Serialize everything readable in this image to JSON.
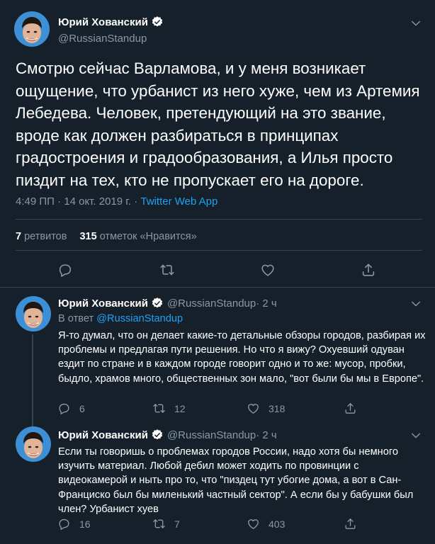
{
  "colors": {
    "background": "#15202b",
    "text": "#ffffff",
    "secondary": "#8899a6",
    "accent": "#1da1f2",
    "border": "#38444d",
    "avatar_bg": "#3d8fd6"
  },
  "main_tweet": {
    "display_name": "Юрий Хованский",
    "handle": "@RussianStandup",
    "text": "Смотрю сейчас Варламова, и у меня возникает ощущение, что урбанист из него хуже, чем из Артемия Лебедева. Человек, претендующий на это звание, вроде как должен разбираться в принципах градостроения и градообразования, а Илья просто пиздит на тех, кто не пропускает его на дороге.",
    "timestamp": "4:49 ПП · 14 окт. 2019 г. · ",
    "source": "Twitter Web App",
    "retweets_count": "7",
    "retweets_label": "ретвитов",
    "likes_count": "315",
    "likes_label": "отметок «Нравится»"
  },
  "replies": [
    {
      "display_name": "Юрий Хованский",
      "handle": "@RussianStandup",
      "time": " · 2 ч",
      "in_reply_prefix": "В ответ ",
      "in_reply_handle": "@RussianStandup",
      "text": "Я-то думал, что он делает какие-то детальные обзоры городов, разбирая их проблемы и предлагая пути решения. Но что я вижу? Охуевший одуван ездит по стране и в каждом городе говорит одно и то же: мусор, пробки, быдло, храмов много, общественных зон мало, \"вот были бы мы в Европе\".",
      "reply_count": "6",
      "retweet_count": "12",
      "like_count": "318"
    },
    {
      "display_name": "Юрий Хованский",
      "handle": "@RussianStandup",
      "time": " · 2 ч",
      "text": "Если ты говоришь о проблемах городов России, надо хотя бы немного изучить материал. Любой дебил может ходить по провинции с видеокамерой и ныть про то, что \"пиздец тут убогие дома, а вот в Сан-Франциско был бы миленький частный сектор\". А если бы у бабушки был член? Урбанист хуев",
      "reply_count": "16",
      "retweet_count": "7",
      "like_count": "403"
    }
  ],
  "icons": {
    "verified": "verified-badge-icon",
    "caret": "chevron-down-icon",
    "reply": "reply-icon",
    "retweet": "retweet-icon",
    "like": "heart-icon",
    "share": "share-icon"
  }
}
